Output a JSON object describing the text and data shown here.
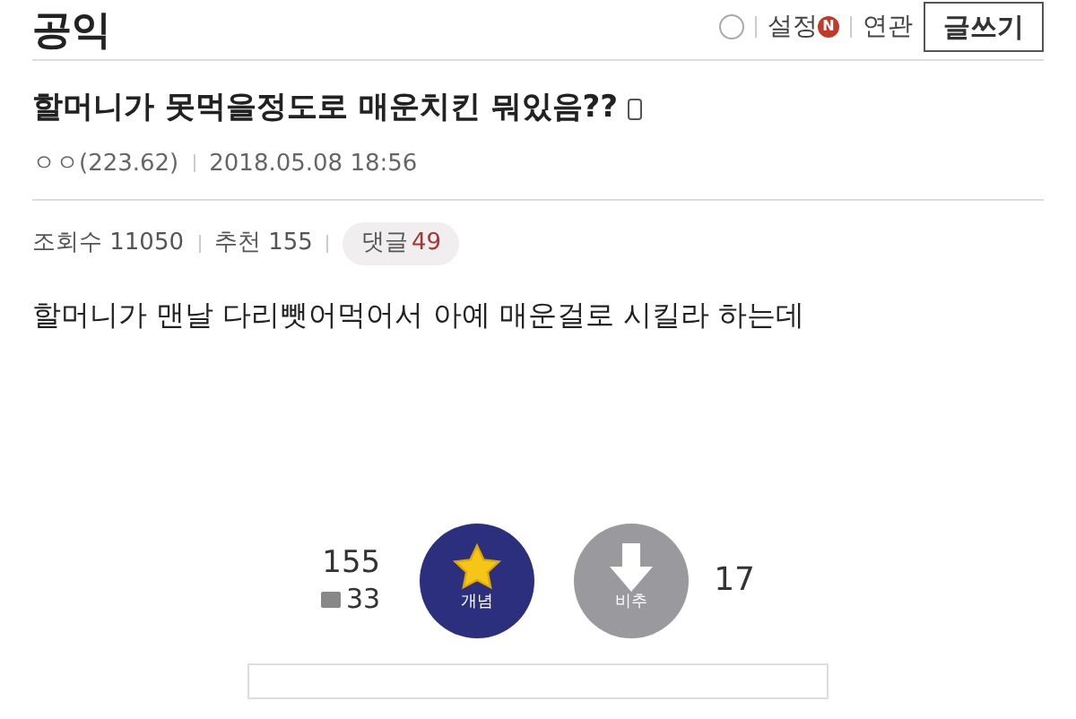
{
  "header": {
    "title": "공익",
    "links": [
      "설정",
      "연관"
    ],
    "new_badge": "N",
    "write_button": "글쓰기"
  },
  "post": {
    "title": "할머니가 못먹을정도로 매운치킨 뭐있음??",
    "author": "ㅇㅇ(223.62)",
    "date": "2018.05.08 18:56",
    "stats": [
      {
        "label": "조회수",
        "value": "11050"
      },
      {
        "label": "추천",
        "value": "155"
      }
    ],
    "comments": {
      "label": "댓글",
      "value": "49"
    },
    "body": "할머니가 맨날 다리뺏어먹어서 아예 매운걸로 시킬라 하는데"
  },
  "votes": {
    "up_count": "155",
    "fixed_count": "33",
    "up_label": "개념",
    "down_label": "비추",
    "down_count": "17"
  }
}
